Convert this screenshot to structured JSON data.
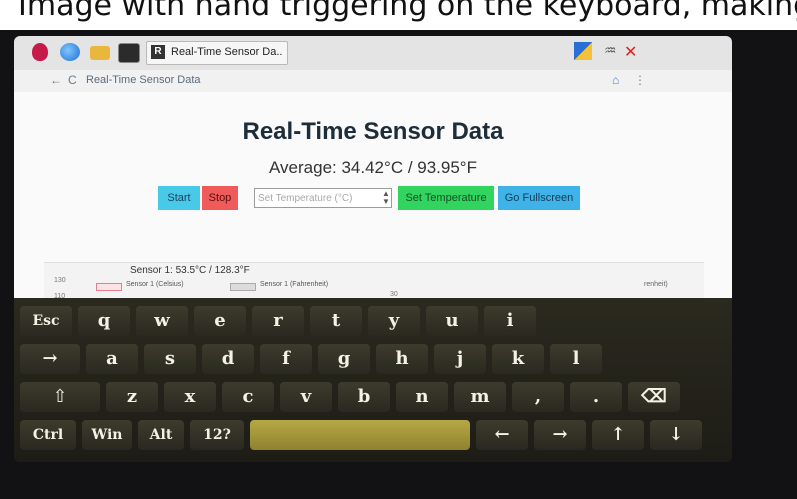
{
  "photo_caption": "Image with hand triggering on the keyboard, making it register as a button press.",
  "taskbar": {
    "task_label": "Real-Time Sensor Da...",
    "task_icon_letter": "R"
  },
  "browser": {
    "back": "←",
    "reload": "C",
    "url_text": "Real-Time Sensor Data"
  },
  "page": {
    "heading": "Real-Time Sensor Data",
    "average": "Average: 34.42°C / 93.95°F",
    "start_label": "Start",
    "stop_label": "Stop",
    "temp_placeholder": "Set Temperature (°C)",
    "set_temp_label": "Set Temperature",
    "fullscreen_label": "Go Fullscreen"
  },
  "chart": {
    "title": "Sensor 1: 53.5°C / 128.3°F",
    "legend_celsius": "Sensor 1 (Celsius)",
    "legend_fahrenheit": "Sensor 1 (Fahrenheit)",
    "tick_130": "130",
    "tick_110": "110",
    "tick_30": "30",
    "right_legend": "renheit)"
  },
  "keyboard": {
    "row1": [
      "Esc",
      "q",
      "w",
      "e",
      "r",
      "t",
      "y",
      "u",
      "i"
    ],
    "row2": [
      "→",
      "a",
      "s",
      "d",
      "f",
      "g",
      "h",
      "j",
      "k",
      "l"
    ],
    "row3": [
      "⇧",
      "z",
      "x",
      "c",
      "v",
      "b",
      "n",
      "m",
      ",",
      ".",
      "⌫"
    ],
    "row4": [
      "Ctrl",
      "Win",
      "Alt",
      "12?",
      "",
      "←",
      "→",
      "↑",
      "↓"
    ]
  },
  "colors": {
    "start": "#49c9e8",
    "stop": "#ef5b5b",
    "set_temperature": "#31d45e",
    "fullscreen": "#3fb2e8",
    "space_key": "#b7a845"
  }
}
